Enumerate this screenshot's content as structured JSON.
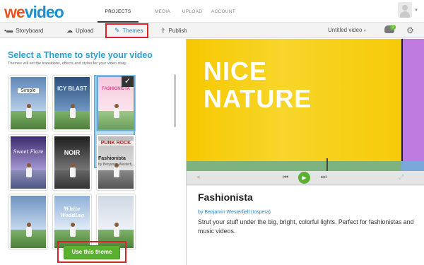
{
  "app": {
    "logo_we": "we",
    "logo_video": "video"
  },
  "nav": {
    "items": [
      "PROJECTS",
      "MEDIA",
      "UPLOAD",
      "ACCOUNT"
    ],
    "active": "PROJECTS"
  },
  "toolbar": {
    "storyboard": "Storyboard",
    "upload": "Upload",
    "themes": "Themes",
    "publish": "Publish",
    "project_title": "Untitled video",
    "notification_count": "1"
  },
  "themes_panel": {
    "heading": "Select a Theme to style your video",
    "subheading": "Themes will set the transitions, effects and styles for your video story.",
    "themes": [
      {
        "label": "Simple",
        "color": "#ffffff"
      },
      {
        "label": "ICY BLAST",
        "color": "#e9f3ff"
      },
      {
        "label": "FASHIONISTA",
        "color": "#e8458b"
      },
      {
        "label": "Sweet Flare",
        "color": "#ffffff"
      },
      {
        "label": "NOIR",
        "color": "#ffffff"
      },
      {
        "label": "PUNK ROCK",
        "color": "#b0201f"
      },
      {
        "label": "",
        "color": "#ffffff"
      },
      {
        "label": "White Wedding",
        "color": "#ffffff"
      },
      {
        "label": "",
        "color": "#ffffff"
      }
    ],
    "selected": {
      "name": "Fashionista",
      "author": "by Benjamin Westerfj..."
    },
    "use_button": "Use this theme"
  },
  "preview": {
    "title_line1": "NICE",
    "title_line2": "NATURE",
    "theme_name": "Fashionista",
    "author": "by Benjamin Westerfjell (Inspera)",
    "description": "Strut your stuff under the big, bright, colorful lights. Perfect for fashionistas and music videos."
  }
}
